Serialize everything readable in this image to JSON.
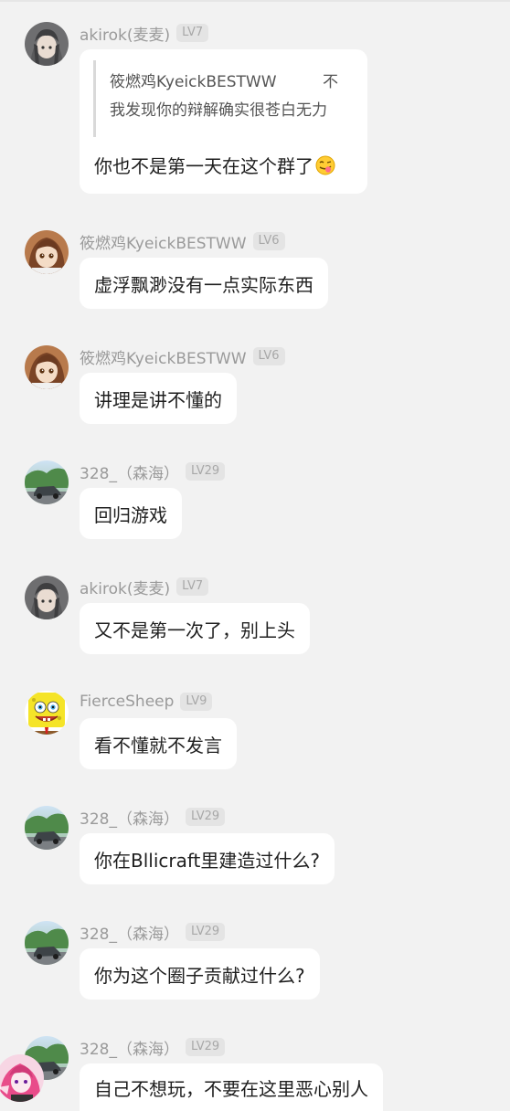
{
  "messages": [
    {
      "user": "akirok(麦麦)",
      "level": "LV7",
      "avatar": "anime-girl-gray-avatar",
      "quote": {
        "author": "筱燃鸡KyeickBESTWW",
        "author_suffix": "不",
        "text": "我发现你的辩解确实很苍白无力"
      },
      "text": "你也不是第一天在这个群了",
      "emoji": "tongue-out-emoji"
    },
    {
      "user": "筱燃鸡KyeickBESTWW",
      "level": "LV6",
      "avatar": "anime-girl-salute-avatar",
      "text": "虚浮飘渺没有一点实际东西"
    },
    {
      "user": "筱燃鸡KyeickBESTWW",
      "level": "LV6",
      "avatar": "anime-girl-salute-avatar",
      "text": "讲理是讲不懂的"
    },
    {
      "user": "328_（森海）",
      "level": "LV29",
      "avatar": "car-landscape-avatar",
      "text": "回归游戏"
    },
    {
      "user": "akirok(麦麦)",
      "level": "LV7",
      "avatar": "anime-girl-gray-avatar",
      "text": "又不是第一次了，别上头"
    },
    {
      "user": "FierceSheep",
      "level": "LV9",
      "avatar": "spongebob-avatar",
      "text": "看不懂就不发言"
    },
    {
      "user": "328_（森海）",
      "level": "LV29",
      "avatar": "car-landscape-avatar",
      "text": "你在Bllicraft里建造过什么?"
    },
    {
      "user": "328_（森海）",
      "level": "LV29",
      "avatar": "car-landscape-avatar",
      "text": "你为这个圈子贡献过什么?"
    },
    {
      "user": "328_（森海）",
      "level": "LV29",
      "avatar": "car-landscape-avatar",
      "text": "自己不想玩，不要在这里恶心别人"
    }
  ],
  "floating_avatar": "anime-character-pink-avatar",
  "colors": {
    "background": "#f2f2f2",
    "bubble": "#ffffff",
    "nickname": "#9a9a9a",
    "level_badge": "#e4e4e4"
  }
}
